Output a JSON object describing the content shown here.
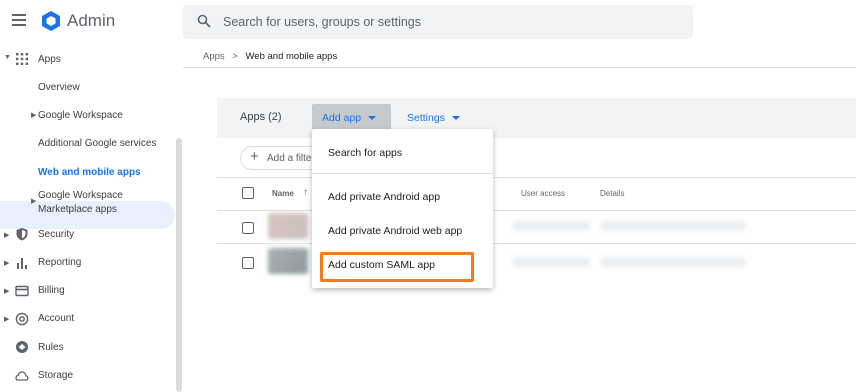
{
  "header": {
    "app_title": "Admin",
    "search_placeholder": "Search for users, groups or settings"
  },
  "sidebar": {
    "items": [
      {
        "label": "Apps",
        "icon": "apps-grid-icon",
        "expanded": true
      },
      {
        "label": "Overview"
      },
      {
        "label": "Google Workspace",
        "has_caret": true
      },
      {
        "label": "Additional Google services"
      },
      {
        "label": "Web and mobile apps",
        "active": true
      },
      {
        "label": "Google Workspace",
        "label2": "Marketplace apps",
        "has_caret": true
      },
      {
        "label": "Security",
        "icon": "shield-icon"
      },
      {
        "label": "Reporting",
        "icon": "bar-chart-icon"
      },
      {
        "label": "Billing",
        "icon": "credit-card-icon"
      },
      {
        "label": "Account",
        "icon": "at-sign-icon"
      },
      {
        "label": "Rules",
        "icon": "rules-icon"
      },
      {
        "label": "Storage",
        "icon": "cloud-icon"
      }
    ]
  },
  "breadcrumb": {
    "root": "Apps",
    "separator": ">",
    "current": "Web and mobile apps"
  },
  "panel": {
    "title": "Apps (2)",
    "add_app_label": "Add app",
    "settings_label": "Settings",
    "filter_label": "Add a filte",
    "columns": {
      "name": "Name",
      "user_access": "User access",
      "details": "Details"
    }
  },
  "dropdown": {
    "items": [
      "Search for apps",
      "Add private Android app",
      "Add private Android web app",
      "Add custom SAML app"
    ],
    "highlighted_item": "Add custom SAML app"
  },
  "colors": {
    "accent": "#1a73e8",
    "active_bg": "#e8f0fe",
    "highlight": "#f07c1d"
  }
}
